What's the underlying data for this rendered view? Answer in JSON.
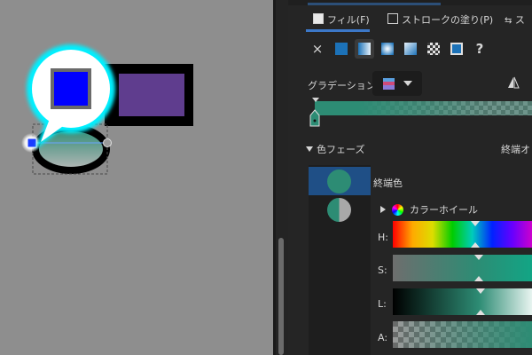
{
  "panel": {
    "tabs": [
      {
        "label": "フィル(F)",
        "active": true
      },
      {
        "label": "ストロークの塗り(P)",
        "active": false
      },
      {
        "label": "ス",
        "active": false
      }
    ],
    "fill_types": [
      "none-icon",
      "flat-color-icon",
      "linear-gradient-icon",
      "radial-gradient-icon",
      "conical-gradient-icon",
      "pattern-icon",
      "swatch-icon",
      "unset-icon"
    ],
    "none_glyph": "×",
    "unset_glyph": "?",
    "gradient_label": "グラデーション:",
    "phases_label": "色フェーズ",
    "phases_right_label": "終端オ",
    "endpoint_label": "終端色",
    "color_wheel_label": "カラーホイール",
    "hsla_labels": [
      "H:",
      "S:",
      "L:",
      "A:"
    ],
    "accent_color": "#2d8c74"
  }
}
